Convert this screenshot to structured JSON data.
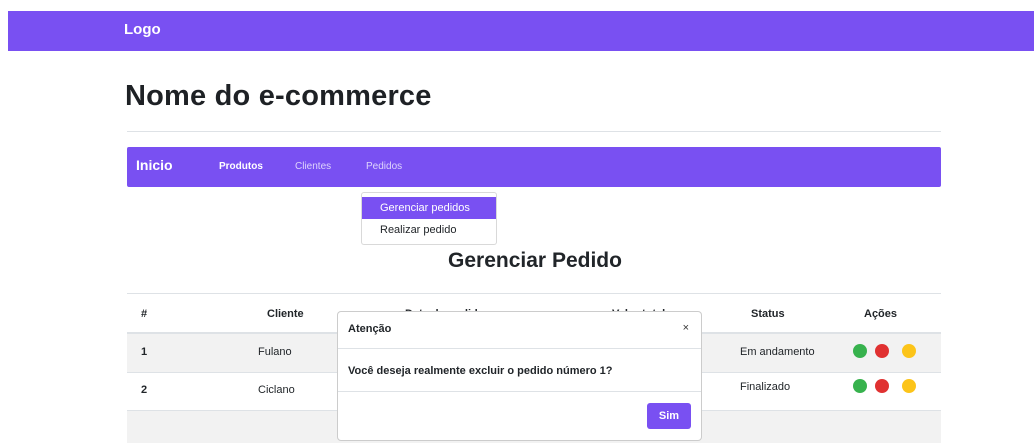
{
  "header": {
    "logo": "Logo"
  },
  "store_title": "Nome do e-commerce",
  "navbar": {
    "brand": "Inicio",
    "links": [
      "Produtos",
      "Clientes",
      "Pedidos"
    ]
  },
  "dropdown": {
    "items": [
      "Gerenciar pedidos",
      "Realizar pedido"
    ],
    "active": "Gerenciar pedidos"
  },
  "page_heading": "Gerenciar Pedido",
  "table": {
    "headers": {
      "num": "#",
      "cliente": "Cliente",
      "data": "Data do pedido",
      "valor": "Valor total",
      "status": "Status",
      "acoes": "Ações"
    },
    "rows": [
      {
        "num": "1",
        "cliente": "Fulano",
        "status": "Em andamento"
      },
      {
        "num": "2",
        "cliente": "Ciclano",
        "status": "Finalizado"
      }
    ],
    "action_icons": [
      "green-action-icon",
      "red-delete-icon",
      "yellow-edit-icon"
    ]
  },
  "modal": {
    "title": "Atenção",
    "close": "×",
    "body": "Você deseja realmente excluir o pedido número 1?",
    "confirm": "Sim"
  },
  "colors": {
    "primary": "#7950f2",
    "green": "#37b24d",
    "red": "#e03131",
    "yellow": "#fcc419"
  }
}
